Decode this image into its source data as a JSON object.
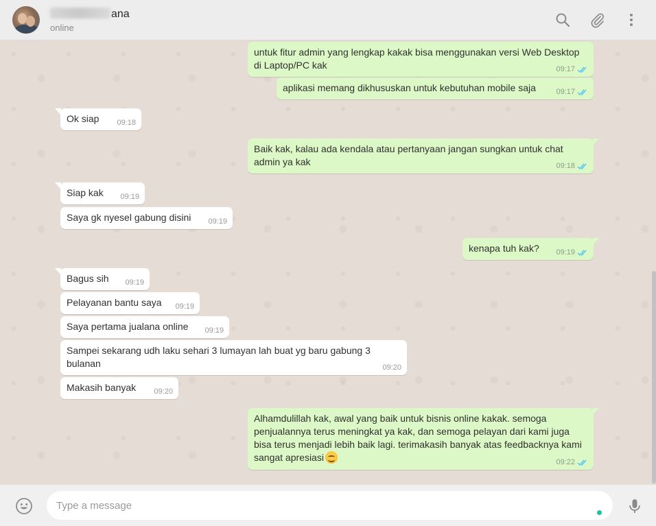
{
  "header": {
    "contact_name_visible": "ana",
    "status": "online",
    "icons": [
      "search-icon",
      "attach-icon",
      "menu-icon"
    ]
  },
  "messages": [
    {
      "dir": "out",
      "text": "untuk fitur admin yang lengkap kakak bisa menggunakan versi Web Desktop di Laptop/PC kak",
      "time": "09:17"
    },
    {
      "dir": "out",
      "text": "aplikasi memang dikhususkan untuk kebutuhan mobile saja",
      "time": "09:17"
    },
    {
      "dir": "in",
      "text": "Ok siap",
      "time": "09:18"
    },
    {
      "dir": "out",
      "text": "Baik kak, kalau ada kendala atau pertanyaan jangan sungkan untuk chat admin ya kak",
      "time": "09:18"
    },
    {
      "dir": "in",
      "text": "Siap kak",
      "time": "09:19"
    },
    {
      "dir": "in",
      "text": "Saya gk nyesel gabung disini",
      "time": "09:19"
    },
    {
      "dir": "out",
      "text": "kenapa tuh kak?",
      "time": "09:19"
    },
    {
      "dir": "in",
      "text": "Bagus sih",
      "time": "09:19"
    },
    {
      "dir": "in",
      "text": "Pelayanan bantu saya",
      "time": "09:19"
    },
    {
      "dir": "in",
      "text": "Saya pertama jualana online",
      "time": "09:19"
    },
    {
      "dir": "in",
      "text": "Sampei sekarang udh laku sehari 3 lumayan lah buat yg baru gabung 3 bulanan",
      "time": "09:20"
    },
    {
      "dir": "in",
      "text": "Makasih banyak",
      "time": "09:20"
    },
    {
      "dir": "out",
      "text": "Alhamdulillah kak, awal yang baik untuk bisnis online kakak. semoga penjualannya terus meningkat ya kak, dan semoga pelayan dari kami juga bisa terus menjadi lebih baik lagi. terimakasih banyak atas feedbacknya kami sangat apresiasi",
      "time": "09:22",
      "emoji": "smiling-face-emoji"
    }
  ],
  "composer": {
    "placeholder": "Type a message",
    "icons": [
      "emoji-icon",
      "mic-icon"
    ]
  },
  "colors": {
    "outgoing_bubble": "#dcf8c6",
    "incoming_bubble": "#ffffff",
    "chat_background": "#e5ddd5",
    "read_ticks": "#4fc3f7"
  }
}
